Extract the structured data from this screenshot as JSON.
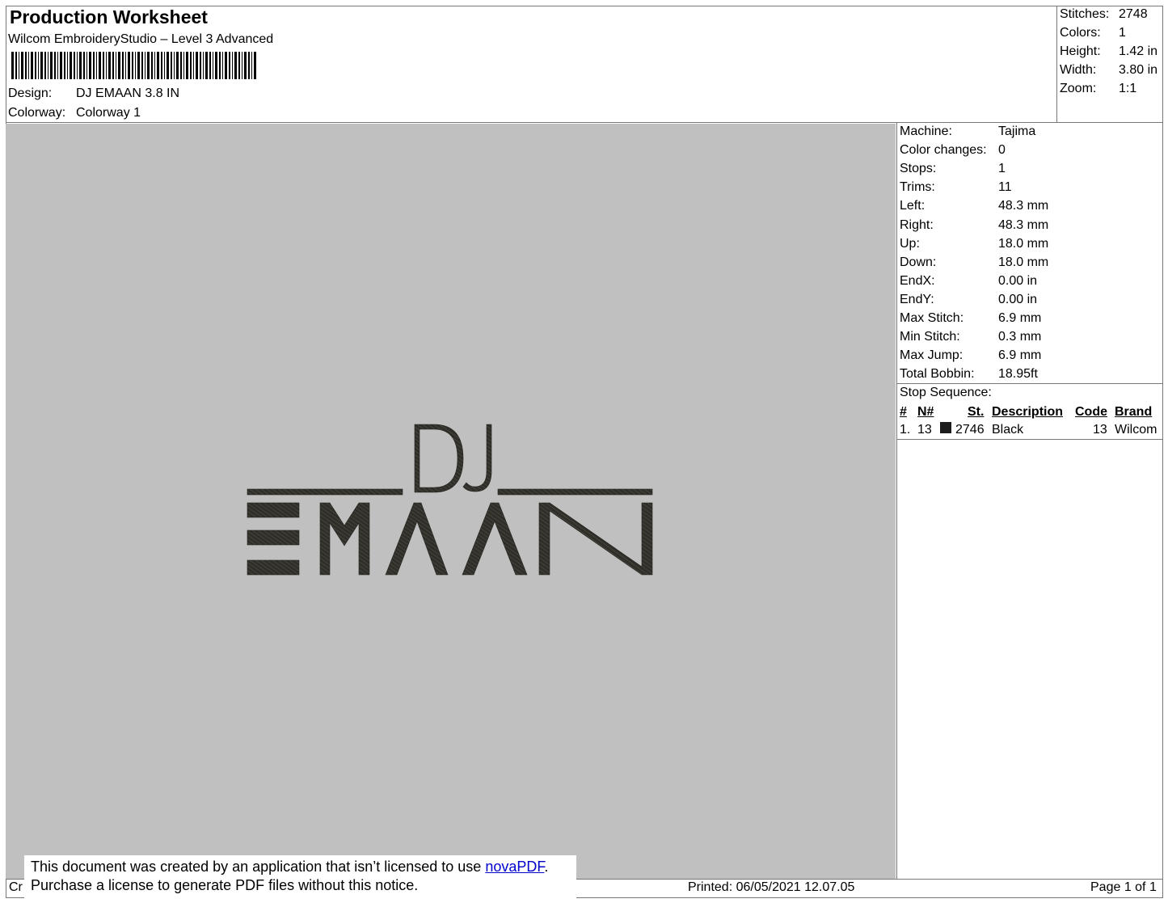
{
  "header": {
    "title": "Production Worksheet",
    "software": "Wilcom EmbroideryStudio – Level 3 Advanced",
    "design_label": "Design:",
    "design_value": "DJ EMAAN 3.8 IN",
    "colorway_label": "Colorway:",
    "colorway_value": "Colorway 1"
  },
  "summary": [
    {
      "label": "Stitches:",
      "value": "2748"
    },
    {
      "label": "Colors:",
      "value": "1"
    },
    {
      "label": "Height:",
      "value": "1.42 in"
    },
    {
      "label": "Width:",
      "value": "3.80 in"
    },
    {
      "label": "Zoom:",
      "value": "1:1"
    }
  ],
  "machine_info": [
    {
      "label": "Machine:",
      "value": "Tajima"
    },
    {
      "label": "Color changes:",
      "value": "0"
    },
    {
      "label": "Stops:",
      "value": "1"
    },
    {
      "label": "Trims:",
      "value": "11"
    },
    {
      "label": "Left:",
      "value": "48.3 mm"
    },
    {
      "label": "Right:",
      "value": "48.3 mm"
    },
    {
      "label": "Up:",
      "value": "18.0 mm"
    },
    {
      "label": "Down:",
      "value": "18.0 mm"
    },
    {
      "label": "EndX:",
      "value": "0.00 in"
    },
    {
      "label": "EndY:",
      "value": "0.00 in"
    },
    {
      "label": "Max Stitch:",
      "value": "6.9 mm"
    },
    {
      "label": "Min Stitch:",
      "value": "0.3 mm"
    },
    {
      "label": "Max Jump:",
      "value": "6.9 mm"
    },
    {
      "label": "Total Bobbin:",
      "value": "18.95ft"
    }
  ],
  "stop_sequence": {
    "title": "Stop Sequence:",
    "headers": [
      "#",
      "N#",
      "St.",
      "Description",
      "Code",
      "Brand"
    ],
    "rows": [
      {
        "index": "1.",
        "needle": "13",
        "stitches": "2746",
        "description": "Black",
        "code": "13",
        "brand": "Wilcom",
        "swatch": "#1c1c1c"
      }
    ]
  },
  "design_preview": {
    "text_top": "DJ",
    "text_bottom": "EMAAN",
    "thread_color": "#2f2e28",
    "background": "#c0c0c0"
  },
  "notice": {
    "line1_prefix": "This document was created by an application that isn’t licensed to use ",
    "link": "novaPDF",
    "line1_suffix": ".",
    "line2": "Purchase a license to generate PDF files without this notice."
  },
  "footer": {
    "left_fragment": "Cr",
    "printed": "Printed: 06/05/2021 12.07.05",
    "page": "Page 1 of 1"
  }
}
